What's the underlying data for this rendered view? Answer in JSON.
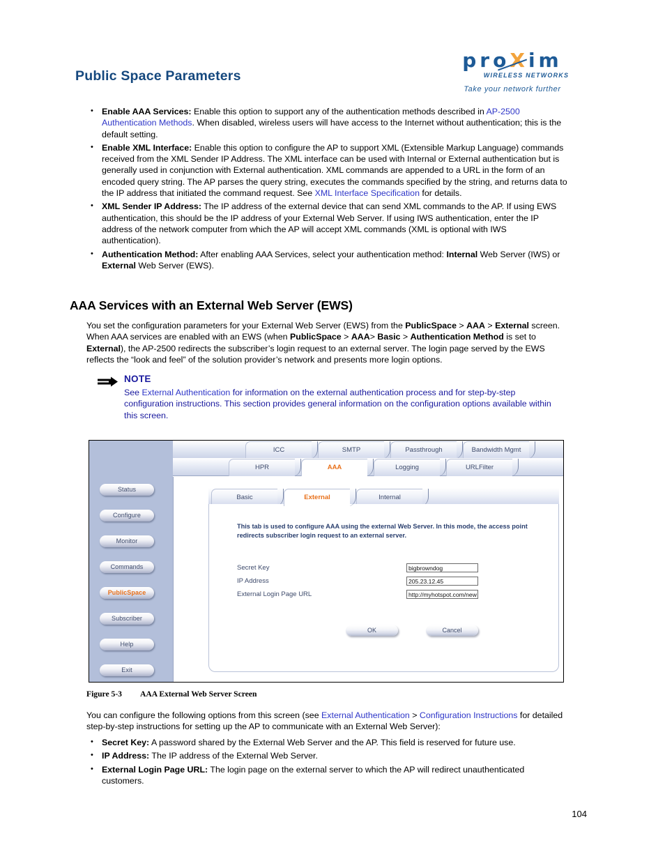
{
  "header": {
    "title": "Public Space Parameters",
    "logo": {
      "word_part1": "pro",
      "word_x": "X",
      "word_part2": "im",
      "subtitle": "WIRELESS NETWORKS",
      "tagline": "Take your network further",
      "brand_color": "#1d5a96",
      "accent_color": "#f2a33c"
    }
  },
  "intro_bullets": [
    {
      "term": "Enable AAA Services:",
      "parts": [
        {
          "t": "text",
          "v": " Enable this option to support any of the authentication methods described in "
        },
        {
          "t": "link",
          "v": "AP-2500 Authentication Methods"
        },
        {
          "t": "text",
          "v": ". When disabled, wireless users will have access to the Internet without authentication; this is the default setting."
        }
      ]
    },
    {
      "term": "Enable XML Interface:",
      "parts": [
        {
          "t": "text",
          "v": " Enable this option to configure the AP to support XML (Extensible Markup Language) commands received from the XML Sender IP Address. The XML interface can be used with Internal or External authentication but is generally used in conjunction with External authentication. XML commands are appended to a URL in the form of an encoded query string. The AP parses the query string, executes the commands specified by the string, and returns data to the IP address that initiated the command request. See "
        },
        {
          "t": "link",
          "v": "XML Interface Specification"
        },
        {
          "t": "text",
          "v": " for details."
        }
      ]
    },
    {
      "term": "XML Sender IP Address:",
      "parts": [
        {
          "t": "text",
          "v": " The IP address of the external device that can send XML commands to the AP. If using EWS authentication, this should be the IP address of your External Web Server. If using IWS authentication, enter the IP address of the network computer from which the AP will accept XML commands (XML is optional with IWS authentication)."
        }
      ]
    },
    {
      "term": "Authentication Method:",
      "parts": [
        {
          "t": "text",
          "v": " After enabling AAA Services, select your authentication method: "
        },
        {
          "t": "bold",
          "v": "Internal"
        },
        {
          "t": "text",
          "v": " Web Server (IWS) or "
        },
        {
          "t": "bold",
          "v": "External"
        },
        {
          "t": "text",
          "v": " Web Server (EWS)."
        }
      ]
    }
  ],
  "section": {
    "heading": "AAA Services with an External Web Server (EWS)",
    "paragraph_parts": [
      {
        "t": "text",
        "v": "You set the configuration parameters for your External Web Server (EWS) from the "
      },
      {
        "t": "bold",
        "v": "PublicSpace"
      },
      {
        "t": "text",
        "v": " > "
      },
      {
        "t": "bold",
        "v": "AAA"
      },
      {
        "t": "text",
        "v": " > "
      },
      {
        "t": "bold",
        "v": "External"
      },
      {
        "t": "text",
        "v": " screen. When AAA services are enabled with an EWS (when "
      },
      {
        "t": "bold",
        "v": "PublicSpace"
      },
      {
        "t": "text",
        "v": " > "
      },
      {
        "t": "bold",
        "v": "AAA"
      },
      {
        "t": "text",
        "v": "> "
      },
      {
        "t": "bold",
        "v": "Basic"
      },
      {
        "t": "text",
        "v": " > "
      },
      {
        "t": "bold",
        "v": "Authentication Method"
      },
      {
        "t": "text",
        "v": " is set to "
      },
      {
        "t": "bold",
        "v": "External"
      },
      {
        "t": "text",
        "v": "), the AP-2500 redirects the subscriber’s login request to an external server. The login page served by the EWS reflects the “look and feel” of the solution provider’s network and presents more login options."
      }
    ]
  },
  "note": {
    "icon": "arrow-note-icon",
    "label": "NOTE",
    "body_parts": [
      {
        "t": "text",
        "v": "See "
      },
      {
        "t": "link",
        "v": "External Authentication"
      },
      {
        "t": "text",
        "v": " for information on the external authentication process and for step-by-step configuration instructions. This section provides general information on the configuration options available within this screen."
      }
    ],
    "color": "#1a1a9e"
  },
  "figure": {
    "caption_number": "Figure 5-3",
    "caption_text": "AAA External Web Server Screen",
    "app": {
      "sidebar": [
        {
          "label": "Status",
          "active": false
        },
        {
          "label": "Configure",
          "active": false
        },
        {
          "label": "Monitor",
          "active": false
        },
        {
          "label": "Commands",
          "active": false
        },
        {
          "label": "PublicSpace",
          "active": true
        },
        {
          "label": "Subscriber",
          "active": false
        },
        {
          "label": "Help",
          "active": false
        },
        {
          "label": "Exit",
          "active": false
        }
      ],
      "tabs_row1": [
        {
          "label": "ICC",
          "selected": false
        },
        {
          "label": "SMTP",
          "selected": false
        },
        {
          "label": "Passthrough",
          "selected": false
        },
        {
          "label": "Bandwidth Mgmt",
          "selected": false
        }
      ],
      "tabs_row2": [
        {
          "label": "HPR",
          "selected": false
        },
        {
          "label": "AAA",
          "selected": true
        },
        {
          "label": "Logging",
          "selected": false
        },
        {
          "label": "URLFilter",
          "selected": false
        }
      ],
      "inner_tabs": [
        {
          "label": "Basic",
          "selected": false
        },
        {
          "label": "External",
          "selected": true
        },
        {
          "label": "Internal",
          "selected": false
        }
      ],
      "card_note": "This tab is used to configure AAA using the external Web Server. In this mode, the access point redirects subscriber login request to an external server.",
      "fields": [
        {
          "label": "Secret Key",
          "value": "bigbrowndog"
        },
        {
          "label": "IP Address",
          "value": "205.23.12.45"
        },
        {
          "label": "External Login Page URL",
          "value": "http://myhotspot.com/new"
        }
      ],
      "buttons": [
        {
          "label": "OK"
        },
        {
          "label": "Cancel"
        }
      ],
      "active_color": "#e8701a",
      "sidebar_color": "#b3bfda"
    }
  },
  "after_figure": {
    "paragraph_parts": [
      {
        "t": "text",
        "v": "You can configure the following options from this screen (see "
      },
      {
        "t": "link",
        "v": "External Authentication"
      },
      {
        "t": "text",
        "v": " > "
      },
      {
        "t": "link",
        "v": "Configuration Instructions"
      },
      {
        "t": "text",
        "v": " for detailed step-by-step instructions for setting up the AP to communicate with an External Web Server):"
      }
    ],
    "bullets": [
      {
        "term": "Secret Key:",
        "parts": [
          {
            "t": "text",
            "v": " A password shared by the External Web Server and the AP. This field is reserved for future use."
          }
        ]
      },
      {
        "term": "IP Address:",
        "parts": [
          {
            "t": "text",
            "v": " The IP address of the External Web Server."
          }
        ]
      },
      {
        "term": "External Login Page URL:",
        "parts": [
          {
            "t": "text",
            "v": " The login page on the external server to which the AP will redirect unauthenticated customers."
          }
        ]
      }
    ]
  },
  "page_number": "104"
}
